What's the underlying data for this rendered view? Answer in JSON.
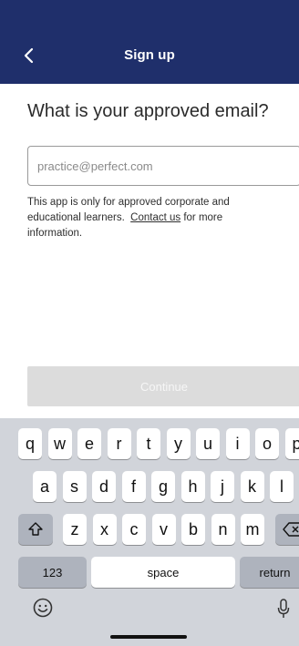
{
  "header": {
    "title": "Sign up",
    "background_color": "#1f2f6b",
    "back_icon": "chevron-left-icon"
  },
  "main": {
    "heading": "What is your approved email?",
    "email_placeholder": "practice@perfect.com",
    "email_value": "",
    "help_prefix": "This app is only for approved corporate and educational learners.",
    "help_link": "Contact us",
    "help_suffix": "for more information.",
    "continue_label": "Continue",
    "continue_enabled": false
  },
  "keyboard": {
    "row1": [
      "q",
      "w",
      "e",
      "r",
      "t",
      "y",
      "u",
      "i",
      "o",
      "p"
    ],
    "row2": [
      "a",
      "s",
      "d",
      "f",
      "g",
      "h",
      "j",
      "k",
      "l"
    ],
    "row3": [
      "z",
      "x",
      "c",
      "v",
      "b",
      "n",
      "m"
    ],
    "numbers_label": "123",
    "space_label": "space",
    "return_label": "return",
    "shift_icon": "shift-icon",
    "delete_icon": "delete-icon",
    "emoji_icon": "emoji-icon",
    "mic_icon": "microphone-icon"
  }
}
